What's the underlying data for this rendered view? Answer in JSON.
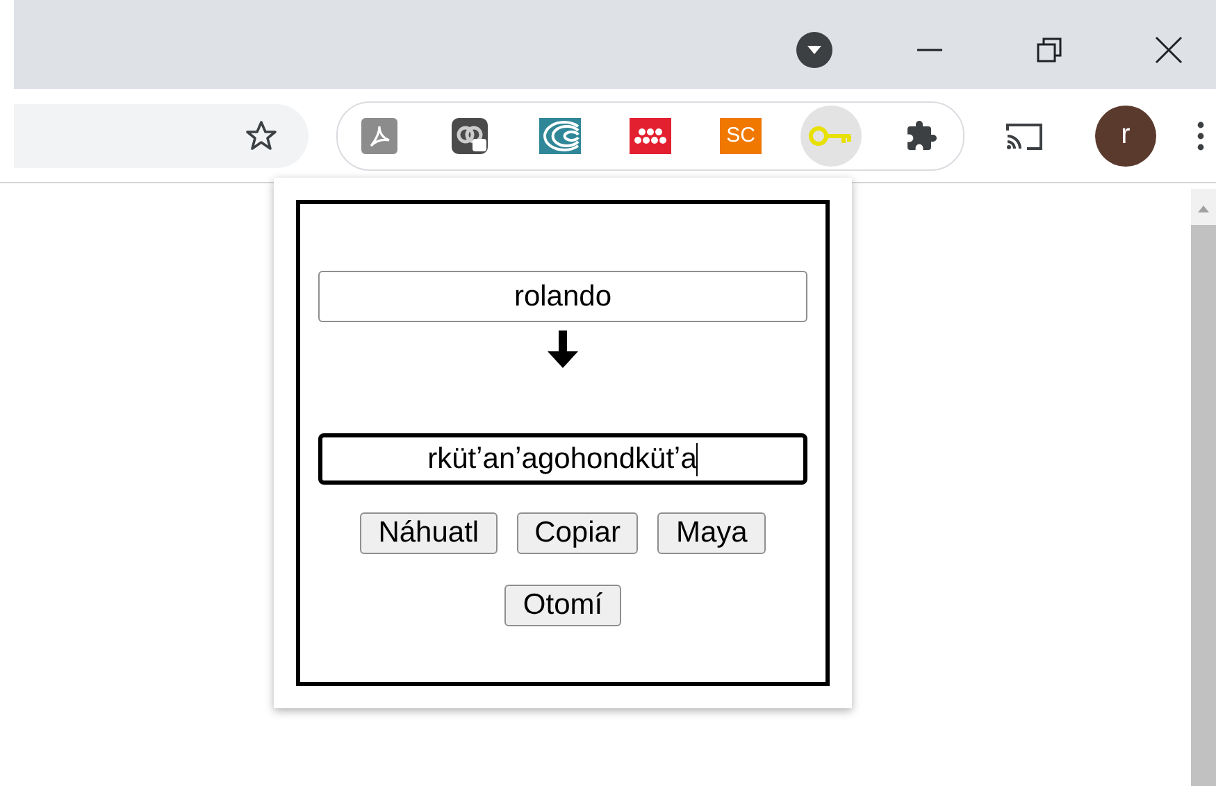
{
  "toolbar": {
    "extensions": [
      {
        "kind": "pdf",
        "selected": false
      },
      {
        "kind": "chat",
        "selected": false
      },
      {
        "kind": "wave",
        "selected": false
      },
      {
        "kind": "dots",
        "selected": false
      },
      {
        "kind": "text",
        "label": "SC",
        "selected": false
      },
      {
        "kind": "key",
        "selected": true
      },
      {
        "kind": "puzzle",
        "selected": false
      }
    ],
    "avatar": "r"
  },
  "popup": {
    "input": {
      "value": "rolando",
      "focused": false
    },
    "output": {
      "value": "rkütʼanʼagohondkütʼa",
      "focused": true
    },
    "buttons": [
      "Náhuatl",
      "Copiar",
      "Maya",
      "Otomí"
    ]
  }
}
